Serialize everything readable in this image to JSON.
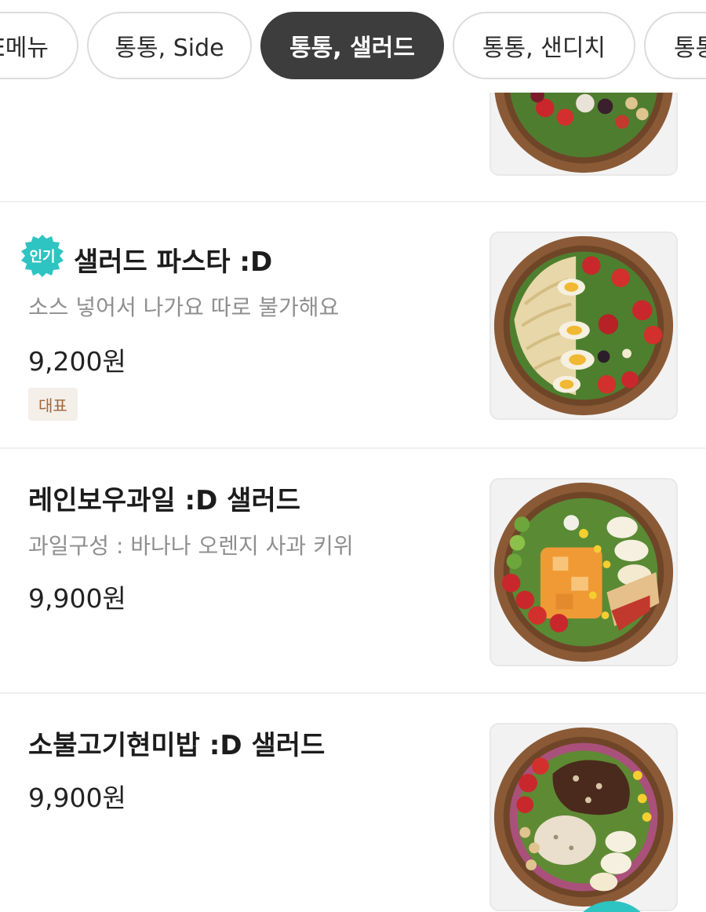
{
  "tabs": [
    {
      "label": "추천메뉴",
      "visible_label": "E메뉴"
    },
    {
      "label": "통통, Side"
    },
    {
      "label": "통통, 샐러드",
      "active": true
    },
    {
      "label": "통통, 샌디치"
    },
    {
      "label": "통통"
    }
  ],
  "menu": {
    "items": [
      {
        "name": "",
        "price": ""
      },
      {
        "badge": "인기",
        "name": "샐러드 파스타 :D",
        "description": "소스 넣어서 나가요 따로 불가해요",
        "price": "9,200원",
        "tag": "대표"
      },
      {
        "name": "레인보우과일 :D 샐러드",
        "description": "과일구성 : 바나나 오렌지 사과 키위",
        "price": "9,900원"
      },
      {
        "name": "소불고기현미밥 :D 샐러드",
        "price": "9,900원"
      }
    ]
  },
  "colors": {
    "active_tab": "#3d3d3d",
    "badge": "#2ec4c1",
    "tag_bg": "#f4efe9",
    "tag_text": "#a0673d"
  }
}
